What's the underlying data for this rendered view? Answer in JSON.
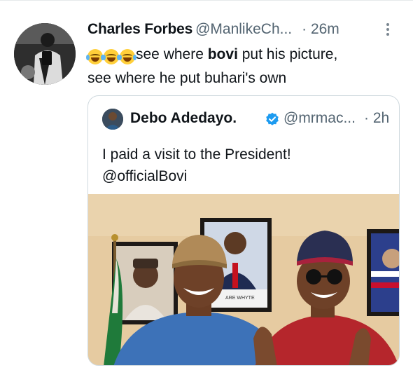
{
  "tweet": {
    "author_name": "Charles Forbes",
    "author_handle": "@ManlikeCh...",
    "time": "· 26m",
    "text_part1": "see where ",
    "text_bold": "bovi",
    "text_part2": " put his picture,",
    "text_line2": "see where he put buhari's own"
  },
  "quote": {
    "author_name": "Debo Adedayo.",
    "author_handle": "@mrmac...",
    "time": "· 2h",
    "text_line1": "I paid a visit to the President!",
    "text_line2": "@officialBovi",
    "photo_frame_caption": "ARE WHYTE"
  },
  "icons": {
    "more": "more-vertical-icon",
    "verified": "verified-badge-icon",
    "emoji": "face-with-tears-of-joy-emoji"
  },
  "colors": {
    "verified_blue": "#1d9bf0",
    "handle_gray": "#536471",
    "border": "#cfd9de"
  }
}
